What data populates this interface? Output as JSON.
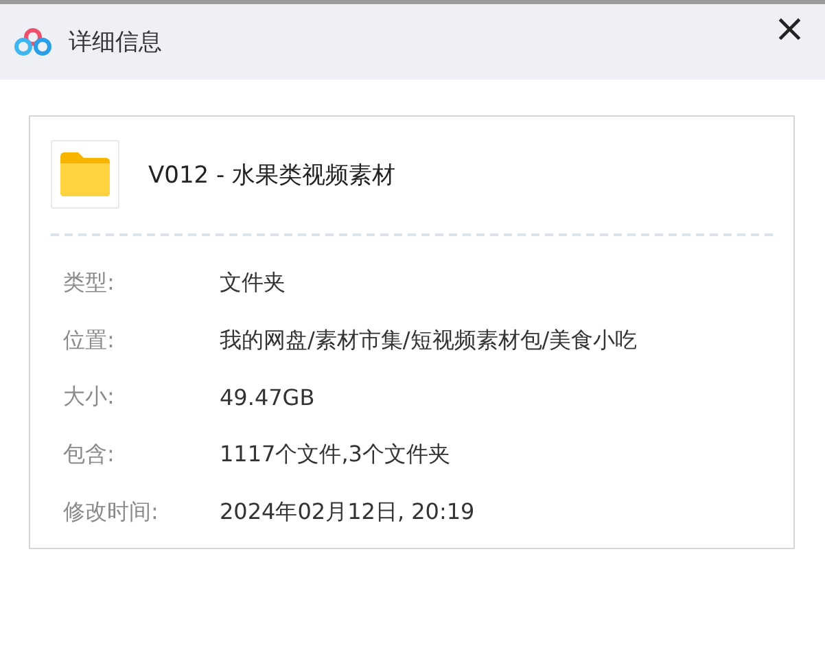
{
  "window": {
    "title": "详细信息",
    "close": "×"
  },
  "file": {
    "name": "V012 - 水果类视频素材"
  },
  "details": [
    {
      "label": "类型:",
      "value": "文件夹"
    },
    {
      "label": "位置:",
      "value": "我的网盘/素材市集/短视频素材包/美食小吃"
    },
    {
      "label": "大小:",
      "value": "49.47GB"
    },
    {
      "label": "包含:",
      "value": "1117个文件,3个文件夹"
    },
    {
      "label": "修改时间:",
      "value": "2024年02月12日, 20:19"
    }
  ]
}
